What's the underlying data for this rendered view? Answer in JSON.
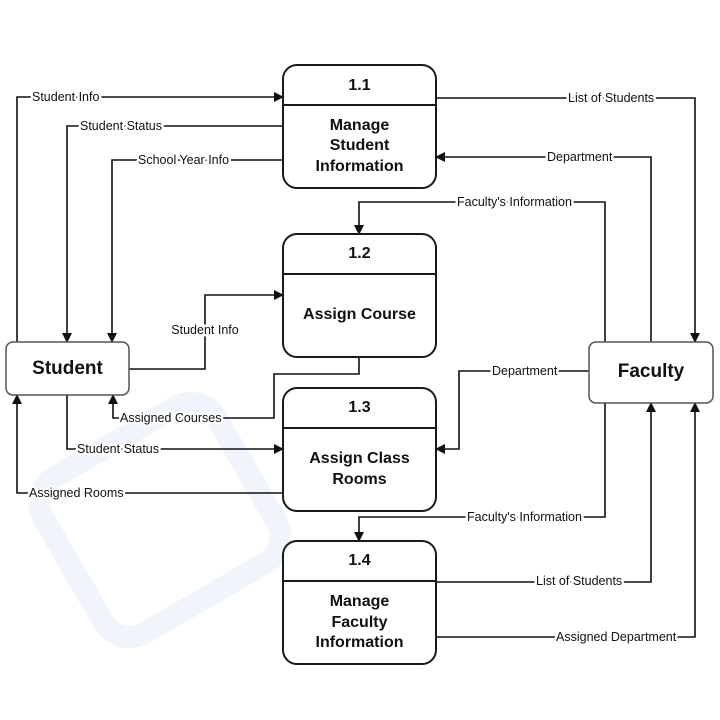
{
  "entities": {
    "student": "Student",
    "faculty": "Faculty"
  },
  "processes": [
    {
      "id": "1.1",
      "lines": [
        "Manage",
        "Student",
        "Information"
      ]
    },
    {
      "id": "1.2",
      "lines": [
        "Assign Course"
      ]
    },
    {
      "id": "1.3",
      "lines": [
        "Assign Class",
        "Rooms"
      ]
    },
    {
      "id": "1.4",
      "lines": [
        "Manage",
        "Faculty",
        "Information"
      ]
    }
  ],
  "flows": {
    "student_info_1": "Student Info",
    "student_status_1": "Student Status",
    "school_year_info": "School Year Info",
    "student_info_2": "Student Info",
    "assigned_courses": "Assigned Courses",
    "student_status_2": "Student Status",
    "assigned_rooms": "Assigned Rooms",
    "list_of_students_1": "List of Students",
    "department_1": "Department",
    "faculty_info_1": "Faculty's Information",
    "department_2": "Department",
    "faculty_info_2": "Faculty's Information",
    "list_of_students_2": "List of Students",
    "assigned_department": "Assigned Department"
  },
  "colors": {
    "line": "#111111",
    "watermark": "#e8f0fb"
  }
}
